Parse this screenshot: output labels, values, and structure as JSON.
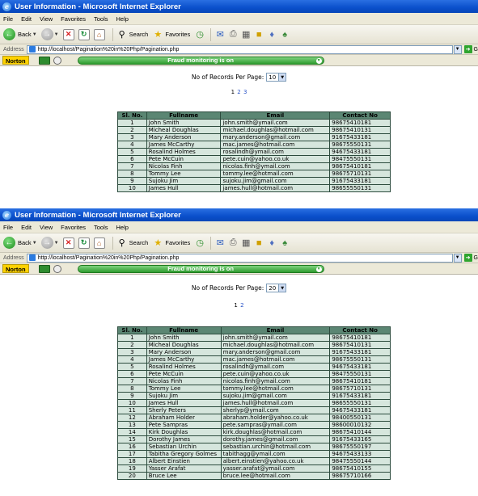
{
  "window": {
    "title": "User Information - Microsoft Internet Explorer",
    "menu": [
      "File",
      "Edit",
      "View",
      "Favorites",
      "Tools",
      "Help"
    ],
    "toolbar": {
      "back_label": "Back",
      "search_label": "Search",
      "favorites_label": "Favorites"
    },
    "address": {
      "label": "Address",
      "url": "http://localhost/Pagination%20in%20Php/Pagination.php",
      "go_label": "G"
    },
    "norton": {
      "logo": "Norton",
      "fraud_text": "Fraud monitoring is on"
    }
  },
  "page": {
    "records_label": "No of Records Per Page:",
    "columns": [
      "Sl. No.",
      "Fullname",
      "Email",
      "Contact No"
    ]
  },
  "views": [
    {
      "per_page": "10",
      "pages": [
        "1",
        "2",
        "3"
      ],
      "current_page": "1",
      "rows": [
        [
          "1",
          "John Smith",
          "john.smith@ymail.com",
          "98675410181"
        ],
        [
          "2",
          "Micheal Doughlas",
          "michael.doughlas@hotmail.com",
          "98675410131"
        ],
        [
          "3",
          "Mary Anderson",
          "mary.anderson@gmail.com",
          "91675433181"
        ],
        [
          "4",
          "James McCarthy",
          "mac.james@hotmail.com",
          "98675550131"
        ],
        [
          "5",
          "Rosalind Holmes",
          "rosalindh@ymail.com",
          "94675433181"
        ],
        [
          "6",
          "Pete McCuin",
          "pete.cuin@yahoo.co.uk",
          "98475550131"
        ],
        [
          "7",
          "Nicolas Finh",
          "nicolas.finh@ymail.com",
          "98675410181"
        ],
        [
          "8",
          "Tommy Lee",
          "tommy.lee@hotmail.com",
          "98675710131"
        ],
        [
          "9",
          "Sujoku Jim",
          "sujoku.jim@gmail.com",
          "91675433181"
        ],
        [
          "10",
          "James Hull",
          "james.hull@hotmail.com",
          "98655550131"
        ]
      ]
    },
    {
      "per_page": "20",
      "pages": [
        "1",
        "2"
      ],
      "current_page": "1",
      "rows": [
        [
          "1",
          "John Smith",
          "john.smith@ymail.com",
          "98675410181"
        ],
        [
          "2",
          "Micheal Doughlas",
          "michael.doughlas@hotmail.com",
          "98675410131"
        ],
        [
          "3",
          "Mary Anderson",
          "mary.anderson@gmail.com",
          "91675433181"
        ],
        [
          "4",
          "James McCarthy",
          "mac.james@hotmail.com",
          "98675550131"
        ],
        [
          "5",
          "Rosalind Holmes",
          "rosalindh@ymail.com",
          "94675433181"
        ],
        [
          "6",
          "Pete McCuin",
          "pete.cuin@yahoo.co.uk",
          "98475550131"
        ],
        [
          "7",
          "Nicolas Finh",
          "nicolas.finh@ymail.com",
          "98675410181"
        ],
        [
          "8",
          "Tommy Lee",
          "tommy.lee@hotmail.com",
          "98675710131"
        ],
        [
          "9",
          "Sujoku Jim",
          "sujoku.jim@gmail.com",
          "91675433181"
        ],
        [
          "10",
          "James Hull",
          "james.hull@hotmail.com",
          "98655550131"
        ],
        [
          "11",
          "Sherly Peters",
          "sherlyp@ymail.com",
          "94675433181"
        ],
        [
          "12",
          "Abraham Holder",
          "abraham.holder@yahoo.co.uk",
          "98400550131"
        ],
        [
          "13",
          "Pete Sampras",
          "pete.sampras@ymail.com",
          "98600010132"
        ],
        [
          "14",
          "Kirk Doughlas",
          "kirk.doughlas@hotmail.com",
          "98675410144"
        ],
        [
          "15",
          "Dorothy James",
          "dorothy.james@gmail.com",
          "91675433165"
        ],
        [
          "16",
          "Sebastian Urchin",
          "sebastian.urchin@hotmail.com",
          "98675550197"
        ],
        [
          "17",
          "Tabitha Gregory Golmes",
          "tabithagg@ymail.com",
          "94675433133"
        ],
        [
          "18",
          "Albert Einstien",
          "albert.einstien@yahoo.co.uk",
          "98475550144"
        ],
        [
          "19",
          "Yasser Arafat",
          "yasser.arafat@ymail.com",
          "98675410155"
        ],
        [
          "20",
          "Bruce Lee",
          "bruce.lee@hotmail.com",
          "98675710166"
        ]
      ]
    }
  ]
}
